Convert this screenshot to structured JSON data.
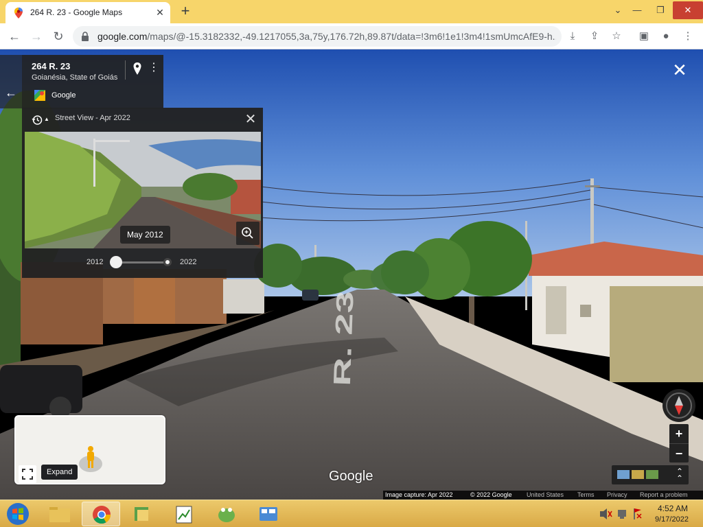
{
  "browser": {
    "tab_title": "264 R. 23 - Google Maps",
    "url_main": "google.com",
    "url_rest": "/maps/@-15.3182332,-49.1217055,3a,75y,176.72h,89.87t/data=!3m6!1e1!3m4!1smUmcAfE9-h..."
  },
  "address_card": {
    "title": "264 R. 23",
    "subtitle": "Goianésia, State of Goiás",
    "brand": "Google"
  },
  "time_machine": {
    "title": "Street View - Apr 2022",
    "selected_date": "May 2012",
    "year_start": "2012",
    "year_end": "2022",
    "slider_position": 0.0
  },
  "minimap": {
    "expand_tooltip": "Expand"
  },
  "street_view": {
    "road_marking": "R. 23",
    "watermark": "Google"
  },
  "footer": {
    "image_capture": "Image capture: Apr 2022",
    "copyright": "© 2022 Google",
    "country": "United States",
    "terms": "Terms",
    "privacy": "Privacy",
    "report": "Report a problem"
  },
  "taskbar": {
    "time": "4:52 AM",
    "date": "9/17/2022"
  },
  "colors": {
    "tabstrip": "#f7d56a",
    "panel_bg": "#222222",
    "sky": "#4d7fd0"
  }
}
